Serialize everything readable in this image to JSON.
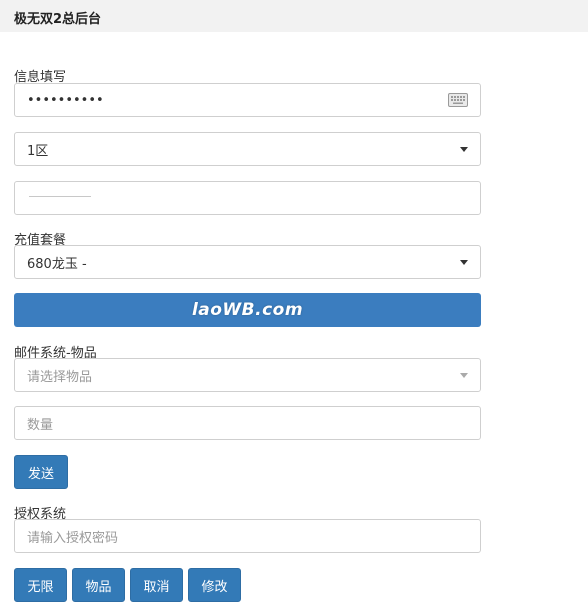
{
  "header": {
    "title": "极无双2总后台"
  },
  "info": {
    "section_label": "信息填写",
    "password_value": "••••••••••",
    "server_selected": "1区",
    "role_value": ""
  },
  "recharge": {
    "section_label": "充值套餐",
    "package_selected": "680龙玉 -",
    "watermark": "laoWB.com"
  },
  "mail": {
    "section_label": "邮件系统-物品",
    "item_placeholder": "请选择物品",
    "quantity_placeholder": "数量",
    "send_label": "发送"
  },
  "auth": {
    "section_label": "授权系统",
    "password_placeholder": "请输入授权密码",
    "buttons": [
      "无限",
      "物品",
      "取消",
      "修改"
    ]
  },
  "colors": {
    "primary": "#337ab7",
    "banner": "#3b7dbf",
    "header_bg": "#f2f2f2"
  }
}
